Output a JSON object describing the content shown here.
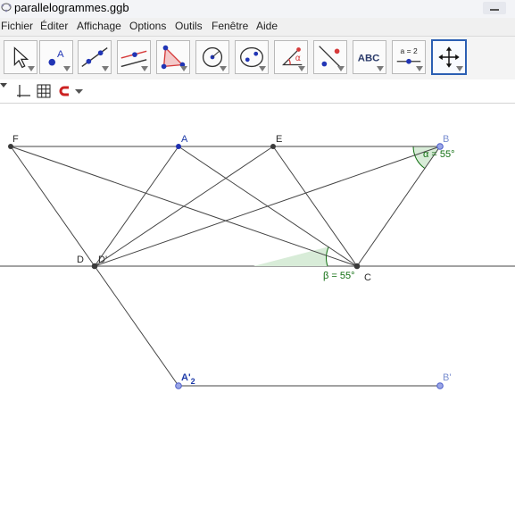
{
  "window": {
    "title": "parallelogrammes.ggb"
  },
  "menu": {
    "items": [
      {
        "name": "menu-fichier",
        "label": "Fichier"
      },
      {
        "name": "menu-editer",
        "label": "Éditer"
      },
      {
        "name": "menu-affichage",
        "label": "Affichage"
      },
      {
        "name": "menu-options",
        "label": "Options"
      },
      {
        "name": "menu-outils",
        "label": "Outils"
      },
      {
        "name": "menu-fenetre",
        "label": "Fenêtre"
      },
      {
        "name": "menu-aide",
        "label": "Aide"
      }
    ]
  },
  "toolbar": {
    "tools": [
      {
        "name": "move-tool",
        "icon": "cursor-arrow-icon"
      },
      {
        "name": "point-tool",
        "icon": "point-icon",
        "label": "A"
      },
      {
        "name": "line-tool",
        "icon": "line-through-points-icon"
      },
      {
        "name": "perpendicular-tool",
        "icon": "parallel-lines-icon"
      },
      {
        "name": "polygon-tool",
        "icon": "polygon-icon"
      },
      {
        "name": "circle-tool",
        "icon": "circle-center-point-icon"
      },
      {
        "name": "conic-tool",
        "icon": "ellipse-icon"
      },
      {
        "name": "angle-tool",
        "icon": "angle-icon",
        "label": "α"
      },
      {
        "name": "reflect-tool",
        "icon": "reflect-about-line-icon"
      },
      {
        "name": "text-tool",
        "icon": "text-icon",
        "label": "ABC"
      },
      {
        "name": "slider-tool",
        "icon": "slider-icon",
        "label": "a = 2"
      },
      {
        "name": "move-view-tool",
        "icon": "move-graphics-view-icon",
        "selected": true
      }
    ]
  },
  "stylebar": {
    "buttons": [
      {
        "name": "axes-toggle",
        "icon": "axes-icon"
      },
      {
        "name": "grid-toggle",
        "icon": "grid-icon"
      },
      {
        "name": "point-capture",
        "icon": "magnet-icon"
      },
      {
        "name": "point-capture-dropdown",
        "icon": "chevron-down-icon"
      }
    ]
  },
  "graphics": {
    "colors": {
      "segment": "#444444",
      "point_black": "#3a3a3a",
      "point_blue": "#1f2fb0",
      "label_blue": "#1d3aa8",
      "label_dark": "#2a2a2a",
      "label_light_blue": "#7a8fd0",
      "angle": "#0f6e0f",
      "angle_fill": "#d8ecd8"
    },
    "points": {
      "F": "F",
      "A": "A",
      "E": "E",
      "B": "B",
      "D": "D",
      "D1": "D'",
      "C": "C",
      "A2": "A'",
      "A2_sub": "2",
      "B2": "B'"
    },
    "angles": {
      "alpha": "α = 55°",
      "beta": "β = 55°"
    }
  }
}
